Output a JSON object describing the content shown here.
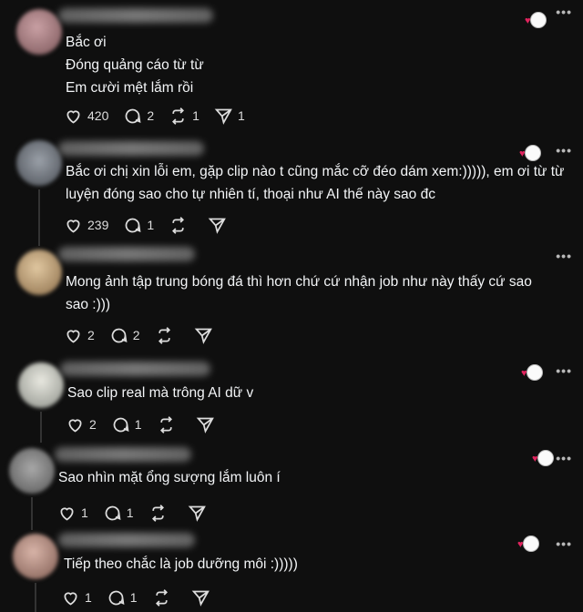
{
  "comments": [
    {
      "lines": [
        "Bắc ơi",
        "Đóng quảng cáo từ từ",
        "Em cười mệt lắm rồi"
      ],
      "likes": "420",
      "replies": "2",
      "reposts": "1",
      "shares": "1"
    },
    {
      "lines": [
        "Bắc ơi chị xin lỗi em, gặp clip nào t cũng mắc cỡ đéo dám xem:))))), em ơi từ từ",
        "luyện đóng sao cho tự nhiên tí, thoại như AI thế này sao đc"
      ],
      "likes": "239",
      "replies": "1",
      "reposts": "",
      "shares": ""
    },
    {
      "lines": [
        "Mong ảnh tập trung bóng đá thì hơn chứ cứ nhận job như này thấy cứ sao",
        "sao :)))"
      ],
      "likes": "2",
      "replies": "2",
      "reposts": "",
      "shares": ""
    },
    {
      "lines": [
        "Sao clip real mà trông AI dữ v"
      ],
      "likes": "2",
      "replies": "1",
      "reposts": "",
      "shares": ""
    },
    {
      "lines": [
        "Sao nhìn mặt ổng sượng lắm luôn í"
      ],
      "likes": "1",
      "replies": "1",
      "reposts": "",
      "shares": ""
    },
    {
      "lines": [
        "Tiếp theo chắc là job dưỡng môi :)))))"
      ],
      "likes": "1",
      "replies": "1",
      "reposts": "",
      "shares": ""
    }
  ],
  "more_glyph": "•••",
  "icons": {
    "like": "heart-icon",
    "reply": "comment-icon",
    "repost": "repost-icon",
    "share": "send-icon"
  },
  "colors": {
    "background": "#0f0f0f",
    "text": "#f3f5f7",
    "heart_badge": "#e0245e"
  }
}
